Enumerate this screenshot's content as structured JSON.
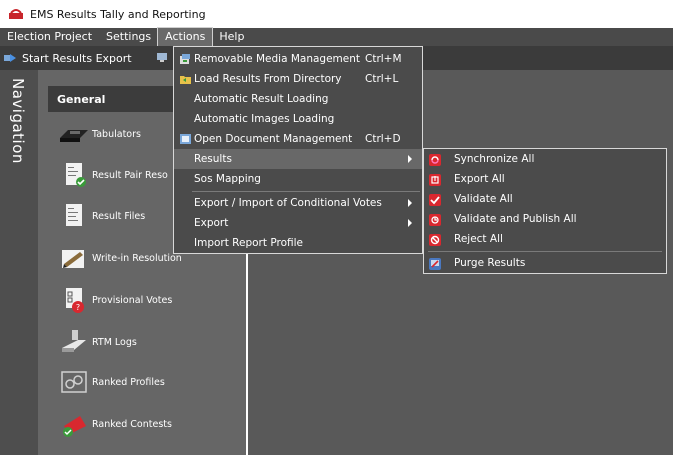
{
  "window": {
    "title": "EMS Results Tally and Reporting",
    "icon": "ems-logo-icon"
  },
  "menubar": [
    {
      "label": "Election Project"
    },
    {
      "label": "Settings"
    },
    {
      "label": "Actions"
    },
    {
      "label": "Help"
    }
  ],
  "toolbar": {
    "start_export_label": "Start Results Export"
  },
  "navigation": {
    "title": "Navigation",
    "section": "General",
    "items": [
      {
        "label": "Tabulators",
        "icon": "tabulator-icon"
      },
      {
        "label": "Result Pair Reso",
        "icon": "result-pair-icon"
      },
      {
        "label": "Result Files",
        "icon": "result-files-icon"
      },
      {
        "label": "Write-in Resolution",
        "icon": "write-in-icon"
      },
      {
        "label": "Provisional Votes",
        "icon": "provisional-votes-icon"
      },
      {
        "label": "RTM Logs",
        "icon": "rtm-logs-icon"
      },
      {
        "label": "Ranked Profiles",
        "icon": "ranked-profiles-icon"
      },
      {
        "label": "Ranked Contests",
        "icon": "ranked-contests-icon"
      }
    ]
  },
  "actions_menu": [
    {
      "label": "Removable Media Management",
      "shortcut": "Ctrl+M",
      "icon": "removable-media-icon"
    },
    {
      "label": "Load Results From Directory",
      "shortcut": "Ctrl+L",
      "icon": "folder-icon"
    },
    {
      "label": "Automatic Result Loading",
      "shortcut": ""
    },
    {
      "label": "Automatic Images Loading",
      "shortcut": ""
    },
    {
      "label": "Open Document Management",
      "shortcut": "Ctrl+D",
      "icon": "document-icon"
    },
    {
      "label": "Results",
      "shortcut": "",
      "submenu": true
    },
    {
      "label": "Sos Mapping",
      "shortcut": ""
    },
    {
      "label": "Export / Import of Conditional Votes",
      "shortcut": "",
      "submenu": true
    },
    {
      "label": "Export",
      "shortcut": "",
      "submenu": true
    },
    {
      "label": "Import Report Profile",
      "shortcut": ""
    }
  ],
  "results_submenu": [
    {
      "label": "Synchronize All",
      "icon": "synchronize-icon"
    },
    {
      "label": "Export All",
      "icon": "export-icon"
    },
    {
      "label": "Validate All",
      "icon": "checkmark-icon"
    },
    {
      "label": "Validate and Publish All",
      "icon": "publish-icon"
    },
    {
      "label": "Reject All",
      "icon": "reject-icon"
    },
    {
      "label": "Purge Results",
      "icon": "purge-icon"
    }
  ],
  "colors": {
    "menu_bg": "#4b4b4b",
    "highlight": "#686868",
    "icon_red": "#d9282f",
    "panel": "#666666"
  }
}
